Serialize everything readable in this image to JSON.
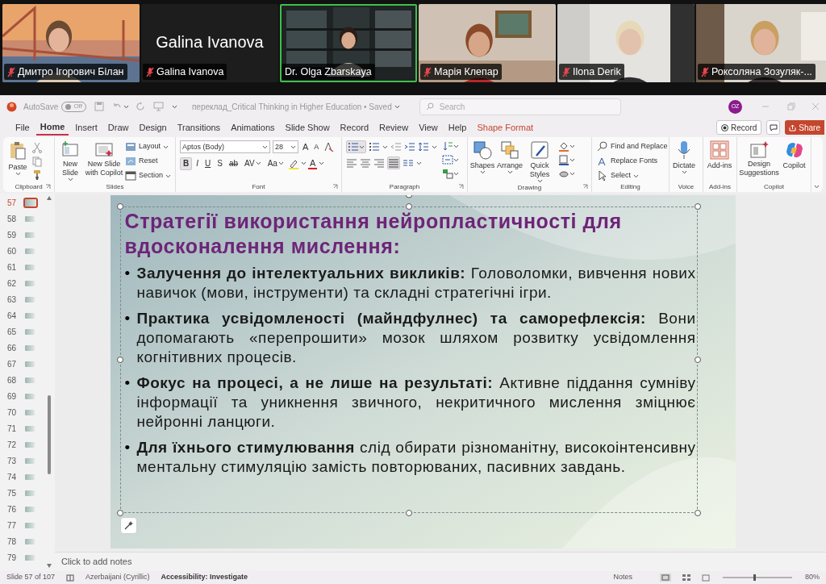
{
  "meeting": {
    "participants": [
      {
        "name": "Дмитро Ігорович Білан",
        "video": true,
        "speaking": false,
        "muted": true
      },
      {
        "name": "Galina Ivanova",
        "video": false,
        "display_name": "Galina Ivanova",
        "speaking": false,
        "muted": true
      },
      {
        "name": "Dr. Olga Zbarskaya",
        "video": true,
        "speaking": true,
        "muted": false
      },
      {
        "name": "Марія Клепар",
        "video": true,
        "speaking": false,
        "muted": true
      },
      {
        "name": "Ilona Derik",
        "video": true,
        "speaking": false,
        "muted": true
      },
      {
        "name": "Роксоляна Зозуляк-...",
        "video": true,
        "speaking": false,
        "muted": true
      }
    ]
  },
  "title_bar": {
    "autosave_label": "AutoSave",
    "autosave_state": "Off",
    "autosave_on": false,
    "document_title": "переклад_Critical Thinking in Higher Education • Saved",
    "search_placeholder": "Search",
    "avatar": "OZ"
  },
  "tabs": [
    {
      "label": "File",
      "selected": false,
      "kind": "normal"
    },
    {
      "label": "Home",
      "selected": true,
      "kind": "normal"
    },
    {
      "label": "Insert",
      "selected": false,
      "kind": "normal"
    },
    {
      "label": "Draw",
      "selected": false,
      "kind": "normal"
    },
    {
      "label": "Design",
      "selected": false,
      "kind": "normal"
    },
    {
      "label": "Transitions",
      "selected": false,
      "kind": "normal"
    },
    {
      "label": "Animations",
      "selected": false,
      "kind": "normal"
    },
    {
      "label": "Slide Show",
      "selected": false,
      "kind": "normal"
    },
    {
      "label": "Record",
      "selected": false,
      "kind": "normal"
    },
    {
      "label": "Review",
      "selected": false,
      "kind": "normal"
    },
    {
      "label": "View",
      "selected": false,
      "kind": "normal"
    },
    {
      "label": "Help",
      "selected": false,
      "kind": "normal"
    },
    {
      "label": "Shape Format",
      "selected": false,
      "kind": "contextual"
    }
  ],
  "tab_actions": {
    "record": "Record",
    "share": "Share"
  },
  "ribbon": {
    "clipboard": {
      "label": "Clipboard",
      "paste": "Paste"
    },
    "slides": {
      "label": "Slides",
      "new_slide": "New Slide",
      "new_slide_copilot": "New Slide with Copilot",
      "layout": "Layout",
      "reset": "Reset",
      "section": "Section"
    },
    "font": {
      "label": "Font",
      "font_name": "Aptos (Body)",
      "font_size": "28",
      "size_buttons": [
        "A",
        "A"
      ],
      "format_buttons": [
        "B",
        "I",
        "U",
        "S",
        "ab",
        "AV",
        "Aa"
      ],
      "font_color": "A"
    },
    "paragraph": {
      "label": "Paragraph"
    },
    "drawing": {
      "label": "Drawing",
      "shapes": "Shapes",
      "arrange": "Arrange",
      "quick_styles": "Quick Styles"
    },
    "editing": {
      "label": "Editing",
      "find_replace": "Find and Replace",
      "replace_fonts": "Replace Fonts",
      "select": "Select"
    },
    "voice": {
      "label": "Voice",
      "dictate": "Dictate"
    },
    "addins": {
      "label": "Add-ins",
      "addins": "Add-ins"
    },
    "copilot": {
      "label": "Copilot",
      "design_suggestions": "Design Suggestions",
      "copilot": "Copilot"
    }
  },
  "thumbnails": [
    {
      "number": "57",
      "selected": true
    },
    {
      "number": "58",
      "selected": false
    },
    {
      "number": "59",
      "selected": false
    },
    {
      "number": "60",
      "selected": false
    },
    {
      "number": "61",
      "selected": false
    },
    {
      "number": "62",
      "selected": false
    },
    {
      "number": "63",
      "selected": false
    },
    {
      "number": "64",
      "selected": false
    },
    {
      "number": "65",
      "selected": false
    },
    {
      "number": "66",
      "selected": false
    },
    {
      "number": "67",
      "selected": false
    },
    {
      "number": "68",
      "selected": false
    },
    {
      "number": "69",
      "selected": false
    },
    {
      "number": "70",
      "selected": false
    },
    {
      "number": "71",
      "selected": false
    },
    {
      "number": "72",
      "selected": false
    },
    {
      "number": "73",
      "selected": false
    },
    {
      "number": "74",
      "selected": false
    },
    {
      "number": "75",
      "selected": false
    },
    {
      "number": "76",
      "selected": false
    },
    {
      "number": "77",
      "selected": false
    },
    {
      "number": "78",
      "selected": false
    },
    {
      "number": "79",
      "selected": false
    }
  ],
  "slide": {
    "title": "Стратегії використання нейропластичності для вдосконалення мислення:",
    "bullet_marker": "•",
    "bullets": [
      "**Залучення до інтелектуальних викликів:** Головоломки, вивчення нових навичок (мови, інструменти) та складні стратегічні ігри.",
      "**Практика усвідомленості (майндфулнес) та саморефлексія:** Вони допомагають «перепрошити» мозок шляхом розвитку усвідомлення когнітивних процесів.",
      "**Фокус на процесі, а не лише на результаті:** Активне піддання сумніву інформації та уникнення звичного, некритичного мислення зміцнює нейронні ланцюги.",
      "**Для їхнього стимулювання** слід обирати різноманітну, високоінтенсивну ментальну стимуляцію замість повторюваних, пасивних завдань."
    ]
  },
  "notes_placeholder": "Click to add notes",
  "status_bar": {
    "slide_counter": "Slide 57 of 107",
    "language": "Azerbaijani (Cyrillic)",
    "accessibility": "Accessibility: Investigate",
    "notes": "Notes",
    "zoom": "80%"
  }
}
